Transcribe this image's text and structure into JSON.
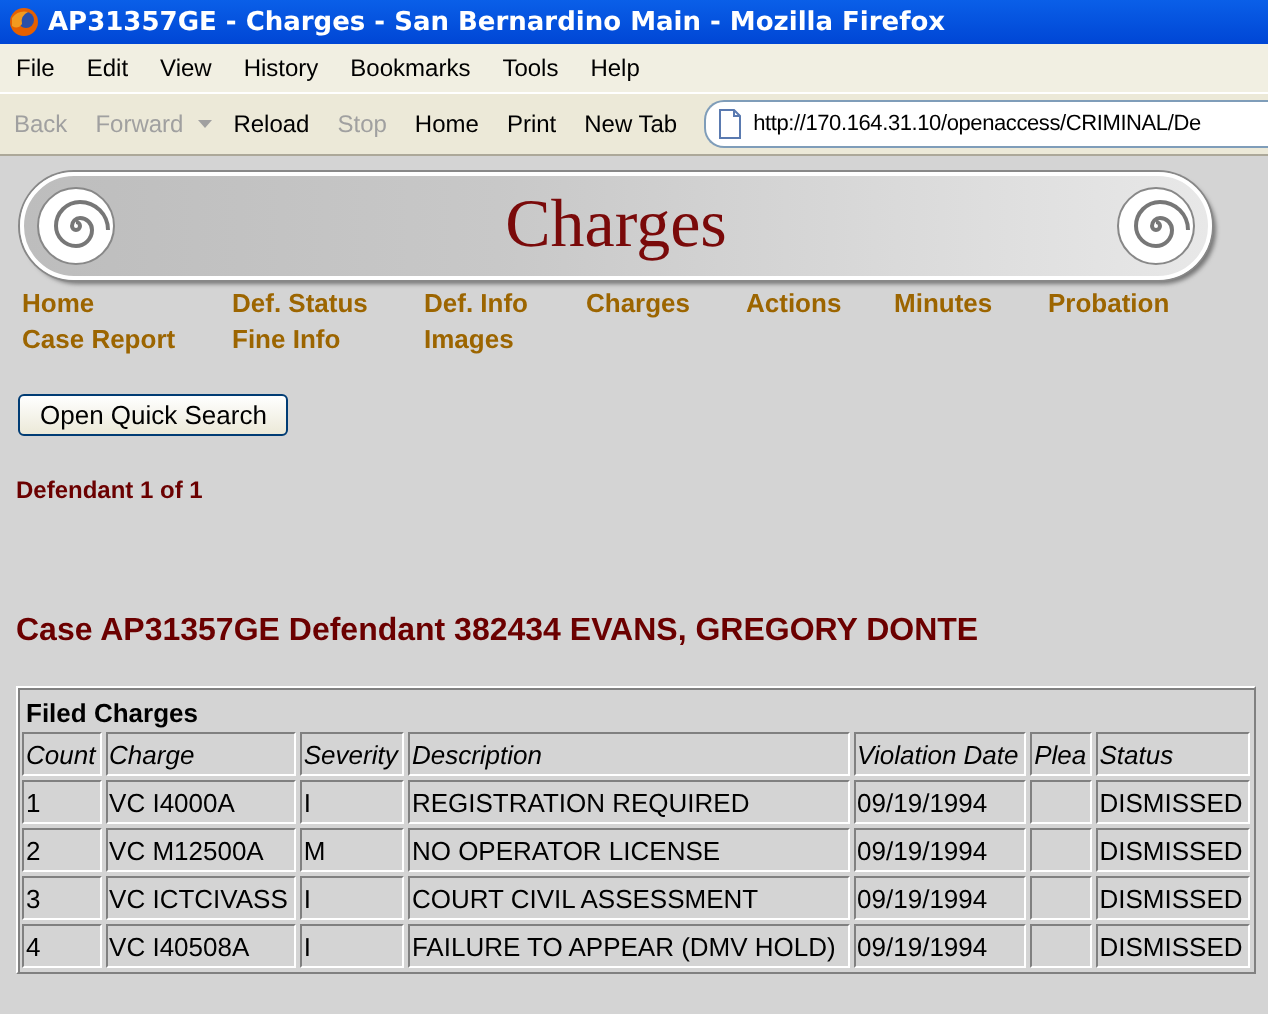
{
  "window": {
    "title": "AP31357GE - Charges - San Bernardino Main - Mozilla Firefox"
  },
  "menu": [
    "File",
    "Edit",
    "View",
    "History",
    "Bookmarks",
    "Tools",
    "Help"
  ],
  "toolbar": [
    {
      "label": "Back",
      "disabled": true
    },
    {
      "label": "Forward",
      "disabled": true
    },
    {
      "label": "Reload",
      "disabled": false
    },
    {
      "label": "Stop",
      "disabled": true
    },
    {
      "label": "Home",
      "disabled": false
    },
    {
      "label": "Print",
      "disabled": false
    },
    {
      "label": "New Tab",
      "disabled": false
    }
  ],
  "address": {
    "value": "http://170.164.31.10/openaccess/CRIMINAL/De"
  },
  "banner": {
    "title": "Charges"
  },
  "nav": [
    "Home",
    "Def. Status",
    "Def. Info",
    "Charges",
    "Actions",
    "Minutes",
    "Probation",
    "Case Report",
    "Fine Info",
    "Images"
  ],
  "quick_search_button": "Open Quick Search",
  "defendant_count": "Defendant 1 of 1",
  "case_heading": "Case AP31357GE Defendant 382434 EVANS, GREGORY DONTE",
  "table": {
    "caption": "Filed Charges",
    "columns": [
      "Count",
      "Charge",
      "Severity",
      "Description",
      "Violation Date",
      "Plea",
      "Status"
    ],
    "rows": [
      [
        "1",
        "VC I4000A",
        "I",
        "REGISTRATION REQUIRED",
        "09/19/1994",
        "",
        "DISMISSED"
      ],
      [
        "2",
        "VC M12500A",
        "M",
        "NO OPERATOR LICENSE",
        "09/19/1994",
        "",
        "DISMISSED"
      ],
      [
        "3",
        "VC ICTCIVASS",
        "I",
        "COURT CIVIL ASSESSMENT",
        "09/19/1994",
        "",
        "DISMISSED"
      ],
      [
        "4",
        "VC I40508A",
        "I",
        "FAILURE TO APPEAR (DMV HOLD)",
        "09/19/1994",
        "",
        "DISMISSED"
      ]
    ]
  }
}
